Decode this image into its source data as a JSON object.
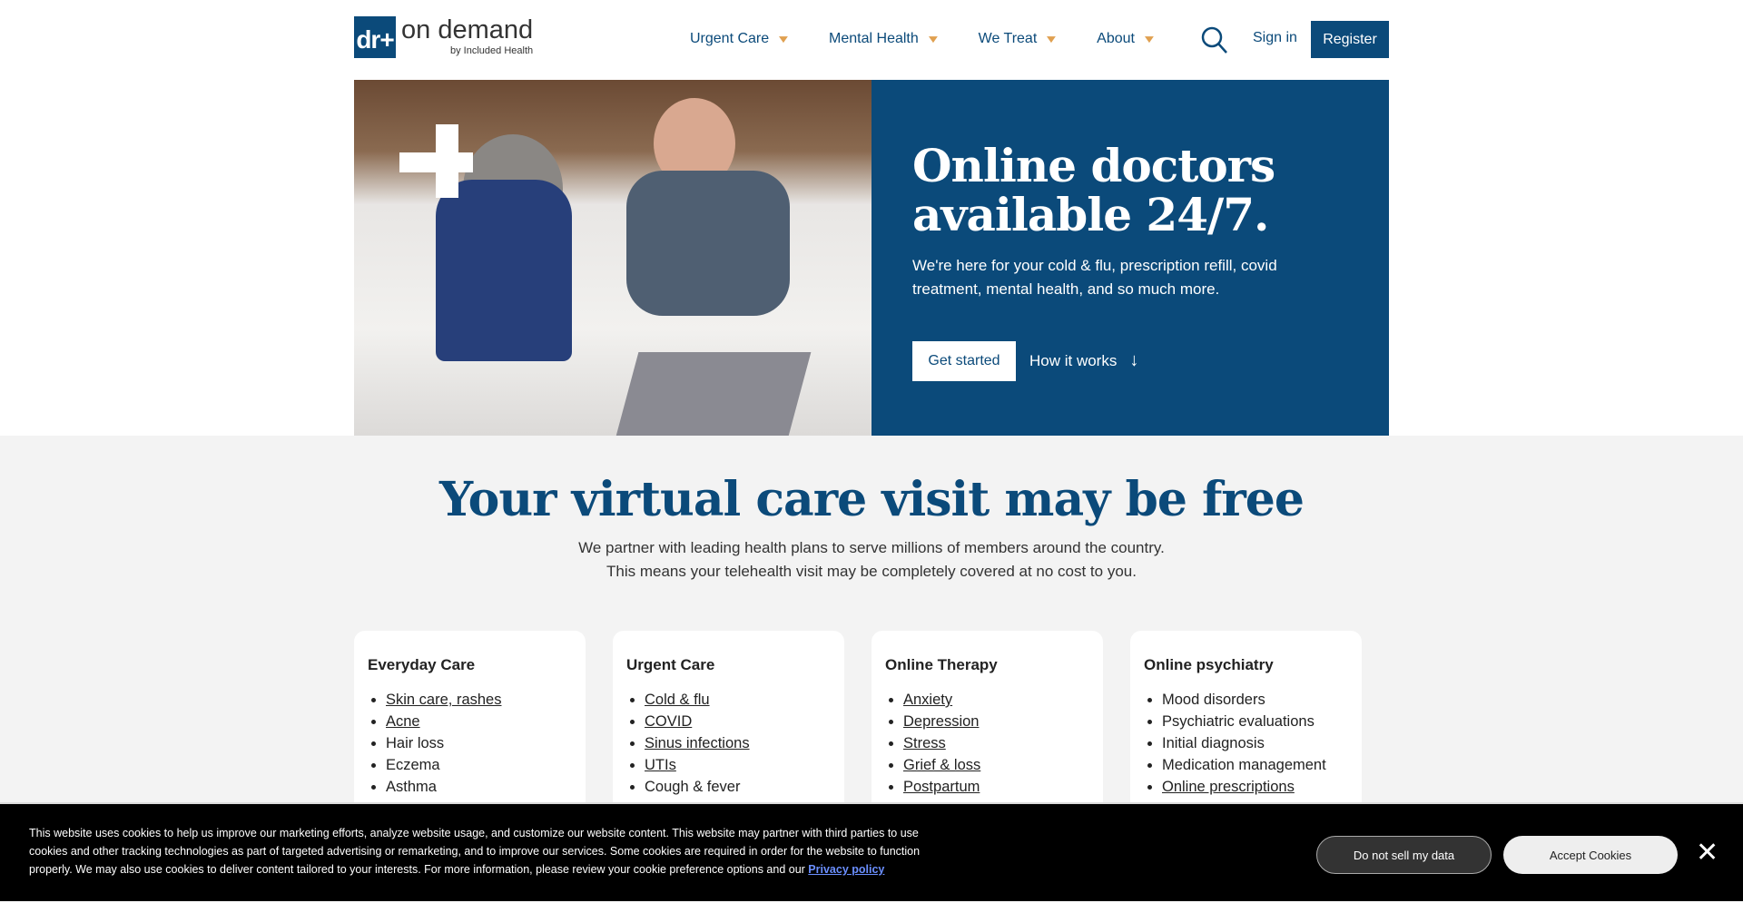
{
  "header": {
    "logo_mark": "dr+",
    "logo_text": "on demand",
    "logo_sub": "by Included Health",
    "nav": [
      {
        "label": "Urgent Care"
      },
      {
        "label": "Mental Health"
      },
      {
        "label": "We Treat"
      },
      {
        "label": "About"
      }
    ],
    "signin": "Sign in",
    "register": "Register"
  },
  "hero": {
    "title": "Online doctors available 24/7.",
    "text": "We're here for your cold & flu, prescription refill, covid treatment, mental health, and so much more.",
    "get_started": "Get started",
    "how_it_works": "How it works"
  },
  "section": {
    "title": "Your virtual care visit may be free",
    "line1": "We partner with leading health plans to serve millions of members around the country.",
    "line2": "This means your telehealth visit may be completely covered at no cost to you."
  },
  "cards": [
    {
      "title": "Everyday Care",
      "items": [
        {
          "t": "Skin care, rashes",
          "link": true
        },
        {
          "t": "Acne",
          "link": true
        },
        {
          "t": "Hair loss"
        },
        {
          "t": "Eczema"
        },
        {
          "t": "Asthma"
        }
      ]
    },
    {
      "title": "Urgent Care",
      "items": [
        {
          "t": "Cold & flu",
          "link": true
        },
        {
          "t": "COVID",
          "link": true
        },
        {
          "t": "Sinus infections",
          "link": true
        },
        {
          "t": "UTIs",
          "link": true
        },
        {
          "t": "Cough & fever"
        }
      ]
    },
    {
      "title": "Online Therapy",
      "items": [
        {
          "t": "Anxiety",
          "link": true
        },
        {
          "t": "Depression",
          "link": true
        },
        {
          "t": "Stress",
          "link": true
        },
        {
          "t": "Grief & loss",
          "link": true
        },
        {
          "t": "Postpartum",
          "link": true
        }
      ]
    },
    {
      "title": "Online psychiatry",
      "items": [
        {
          "t": "Mood disorders"
        },
        {
          "t": "Psychiatric evaluations"
        },
        {
          "t": "Initial diagnosis"
        },
        {
          "t": "Medication management"
        },
        {
          "t": "Online prescriptions",
          "link": true
        }
      ]
    }
  ],
  "cookie": {
    "text": "This website uses cookies to help us improve our marketing efforts, analyze website usage, and customize our website content. This website may partner with third parties to use cookies and other tracking technologies as part of targeted advertising or remarketing, and to improve our services. Some cookies are required in order for the website to function properly. We may also use cookies to deliver content tailored to your interests. For more information, please review your cookie preference options and our ",
    "privacy": "Privacy policy",
    "do_not_sell": "Do not sell my data",
    "accept": "Accept Cookies"
  },
  "colors": {
    "brand": "#0b4a7a",
    "accent": "#e0a050"
  }
}
